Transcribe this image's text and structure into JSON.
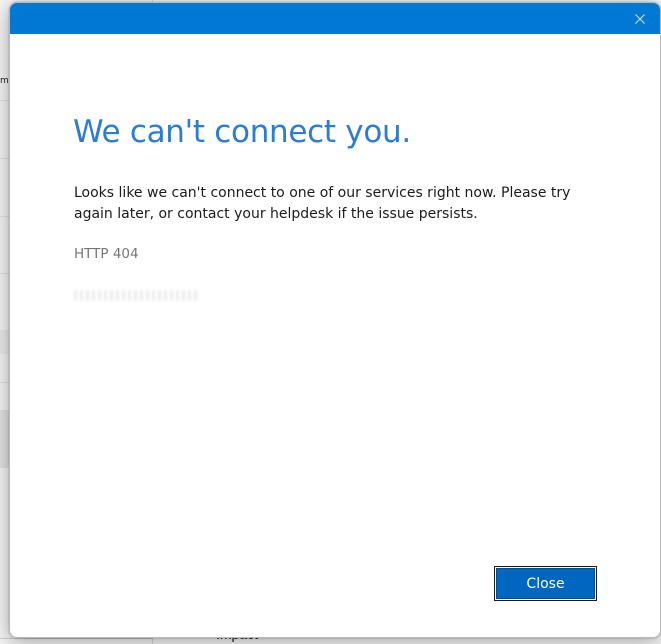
{
  "dialog": {
    "heading": "We can't connect you.",
    "message": "Looks like we can't connect to one of our services right now. Please try again later, or contact your helpdesk if the issue persists.",
    "error_code": "HTTP 404",
    "close_button_label": "Close",
    "titlebar_color": "#0078d4",
    "heading_color": "#2b7cd3",
    "close_icon": "close-icon"
  },
  "background_app": {
    "clipped_text": "mi",
    "bottom_text": "Impact"
  }
}
